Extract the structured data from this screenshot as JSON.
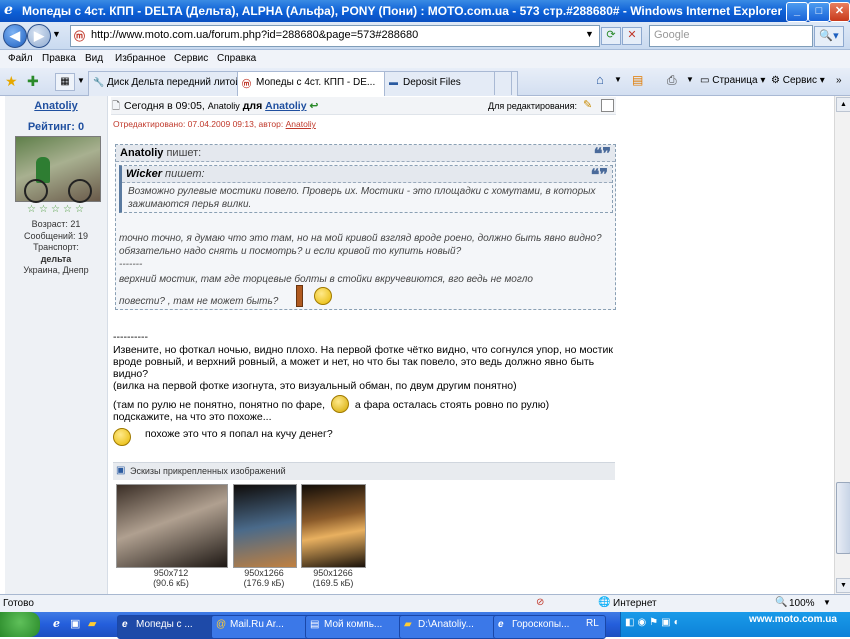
{
  "window": {
    "title": "Мопеды с 4ст. КПП - DELTA (Дельта), ALPHA (Альфа), PONY (Пони) : MOTO.com.ua - 573 стр.#288680# - Windows Internet Explorer"
  },
  "address_bar": {
    "url": "http://www.moto.com.ua/forum.php?id=288680&page=573#288680",
    "search_placeholder": "Google"
  },
  "menu": [
    "Файл",
    "Правка",
    "Вид",
    "Избранное",
    "Сервис",
    "Справка"
  ],
  "tabs": [
    {
      "label": "Диск Дельта передний литой"
    },
    {
      "label": "Мопеды с 4ст. КПП - DE..."
    },
    {
      "label": "Deposit Files"
    }
  ],
  "toolbar": {
    "page_label": "Страница",
    "service_label": "Сервис"
  },
  "user": {
    "name": "Anatoliy",
    "rating_label": "Рейтинг: 0",
    "stars": 5,
    "age": "Возраст: 21",
    "messages": "Сообщений: 19",
    "transport_label": "Транспорт:",
    "transport": "дельта",
    "location": "Украина, Днепр"
  },
  "post": {
    "time_prefix": "Сегодня в 09:05,",
    "author": "Anatoliy",
    "for_word": "для",
    "addressee": "Anatoliy",
    "edit_label": "Для редактирования:",
    "edited_note": "Отредактировано: 07.04.2009 09:13, автор:",
    "edited_by": "Anatoliy",
    "outer_quote_author": "Anatoliy",
    "outer_quote_writes": "пишет:",
    "inner_quote_author": "Wicker",
    "inner_quote_writes": "пишет:",
    "inner_quote_text": "Возможно рулевые мостики повело. Проверь их. Мостики - это площадки с хомутами, в которых зажимаются перья вилки.",
    "outer_quote_line1": "точно точно, я думаю что это там, но на мой кривой взгляд вроде роено, должно быть явно видно? обязательно надо снять и посмотрь? и если кривой то купить новый?",
    "outer_quote_sep": "-------",
    "outer_quote_line2": "верхний мостик, там где торцевые болты в стойки вкручевиются, вго ведь не могло повести? , там не может быть?",
    "separator": "----------",
    "body1": "Извените, но фоткал ночью, видно плохо. На первой фотке чётко видно, что согнулся упор, но мостик вроде ровный, и верхний ровный, а может и нет, но что бы так повело, это ведь должно явно быть видно?",
    "body2": "(вилка на первой фотке изогнута, это визуальный обман, по двум другим понятно)",
    "body3a": "(там по рулю не понятно, понятно по фаре,",
    "body3b": "а фара осталась стоять ровно по рулю)",
    "body4": "подскажите, на что это похоже...",
    "body5": "похоже это что я попал на кучу денег?"
  },
  "attachments": {
    "header": "Эскизы прикрепленных изображений",
    "items": [
      {
        "size": "950x712",
        "weight": "(90.6 кБ)"
      },
      {
        "size": "950x1266",
        "weight": "(176.9 кБ)"
      },
      {
        "size": "950x1266",
        "weight": "(169.5 кБ)"
      }
    ]
  },
  "status": {
    "text": "Готово",
    "zone": "Интернет",
    "zoom": "100%"
  },
  "taskbar": {
    "items": [
      "Мопеды с ...",
      "Mail.Ru Ar...",
      "Мой компь...",
      "D:\\Anatoliy...",
      "Гороскопы..."
    ],
    "lang": "RL",
    "watermark": "www.moto.com.ua"
  },
  "colors": {
    "accent": "#1c5fbf",
    "link": "#1f4f9f",
    "edited": "#c0392b"
  }
}
